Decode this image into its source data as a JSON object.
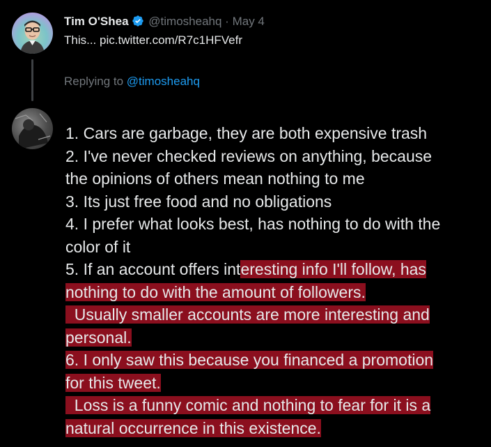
{
  "tweet": {
    "author_name": "Tim O'Shea",
    "handle": "@timosheahq",
    "separator": "·",
    "date": "May 4",
    "text": "This... pic.twitter.com/R7c1HFVefr",
    "verified_color": "#1d9bf0"
  },
  "reply": {
    "replying_to_label": "Replying to",
    "replying_to_handle": "@timosheahq",
    "line1": "1. Cars are garbage, they are both expensive trash",
    "line2a": "2. I've never checked reviews on anything, because",
    "line2b": "the opinions of others mean nothing to me",
    "line3": "3. Its just free food and no obligations",
    "line4a": "4. I prefer what looks best, has nothing to do with the",
    "line4b": "color of it",
    "line5a_plain": "5. If an account offers int",
    "line5a_hl": "eresting info I'll follow, has",
    "line5b": "nothing to do with the amount of followers.",
    "line5c": "  Usually smaller accounts are more interesting and",
    "line5d": "personal.",
    "line6a": "6. I only saw this because you financed a promotion",
    "line6b": "for this tweet.",
    "line6c": "  Loss is a funny comic and nothing to fear for it is a",
    "line6d": "natural occurrence in this existence.",
    "highlight_color": "#8b0f1e"
  }
}
